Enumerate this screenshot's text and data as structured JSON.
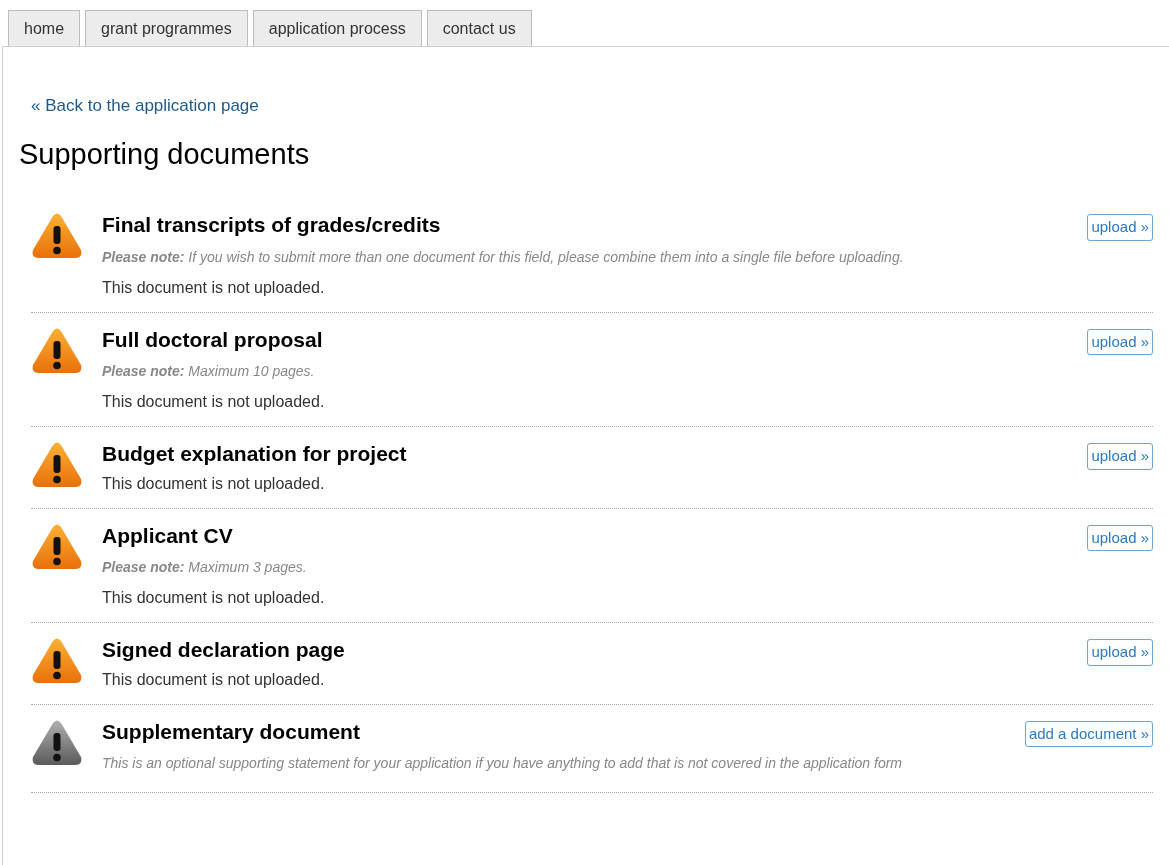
{
  "tabs": [
    {
      "label": "home"
    },
    {
      "label": "grant programmes"
    },
    {
      "label": "application process"
    },
    {
      "label": "contact us"
    }
  ],
  "back_link": "« Back to the application page",
  "heading": "Supporting documents",
  "documents": [
    {
      "kind": "required",
      "title": "Final transcripts of grades/credits",
      "note": "**Please note:** If you wish to submit more than one document for this field, please combine them into a single file before uploading.",
      "status": "This document is not uploaded.",
      "action": "upload »"
    },
    {
      "kind": "required",
      "title": "Full doctoral proposal",
      "note": "**Please note:** Maximum 10 pages.",
      "status": "This document is not uploaded.",
      "action": "upload »"
    },
    {
      "kind": "required",
      "title": "Budget explanation for project",
      "status": "This document is not uploaded.",
      "action": "upload »"
    },
    {
      "kind": "required",
      "title": "Applicant CV",
      "note": "**Please note:** Maximum 3 pages.",
      "status": "This document is not uploaded.",
      "action": "upload »"
    },
    {
      "kind": "required",
      "title": "Signed declaration page",
      "status": "This document is not uploaded.",
      "action": "upload »"
    },
    {
      "kind": "optional",
      "title": "Supplementary document",
      "note": "This is an optional supporting statement for your application if you have anything to add that is not covered in the application form",
      "action": "add a document »"
    }
  ]
}
